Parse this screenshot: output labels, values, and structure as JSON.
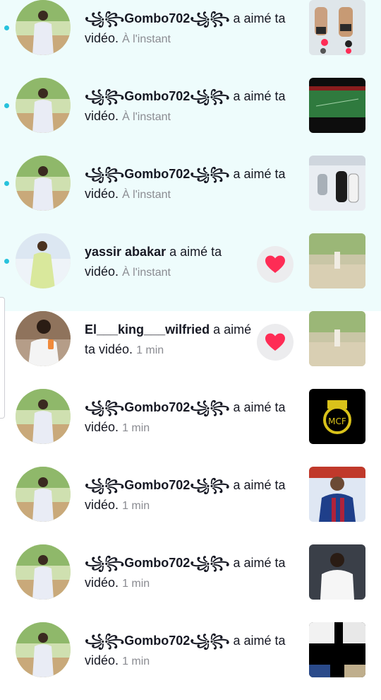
{
  "colors": {
    "unread_bg": "#eefcfc",
    "unread_dot": "#27c2dc",
    "heart": "#fe2c55",
    "time": "#8a8b91"
  },
  "notifications": [
    {
      "user": "꧁꧂Gombo702꧁꧂",
      "action": "a aimé ta vidéo.",
      "time": "À l'instant",
      "unread": true,
      "thumb": "football-players-thumbnail"
    },
    {
      "user": "꧁꧂Gombo702꧁꧂",
      "action": "a aimé ta vidéo.",
      "time": "À l'instant",
      "unread": true,
      "thumb": "football-pitch-thumbnail"
    },
    {
      "user": "꧁꧂Gombo702꧁꧂",
      "action": "a aimé ta vidéo.",
      "time": "À l'instant",
      "unread": true,
      "thumb": "champions-trophy-thumbnail"
    },
    {
      "user": "yassir abakar",
      "action": "a aimé ta vidéo.",
      "time": "À l'instant",
      "unread": true,
      "heart": true,
      "thumb": "courtyard-thumbnail"
    },
    {
      "user": "El___king___wilfried",
      "action": "a aimé ta vidéo.",
      "time": "1 min",
      "unread": false,
      "heart": true,
      "thumb": "courtyard-thumbnail"
    },
    {
      "user": "꧁꧂Gombo702꧁꧂",
      "action": "a aimé ta vidéo.",
      "time": "1 min",
      "unread": false,
      "thumb": "real-madrid-crest-thumbnail"
    },
    {
      "user": "꧁꧂Gombo702꧁꧂",
      "action": "a aimé ta vidéo.",
      "time": "1 min",
      "unread": false,
      "thumb": "barcelona-player-thumbnail"
    },
    {
      "user": "꧁꧂Gombo702꧁꧂",
      "action": "a aimé ta vidéo.",
      "time": "1 min",
      "unread": false,
      "thumb": "madrid-player-thumbnail"
    },
    {
      "user": "꧁꧂Gombo702꧁꧂",
      "action": "a aimé ta vidéo.",
      "time": "1 min",
      "unread": false,
      "thumb": "dark-collage-thumbnail"
    }
  ]
}
